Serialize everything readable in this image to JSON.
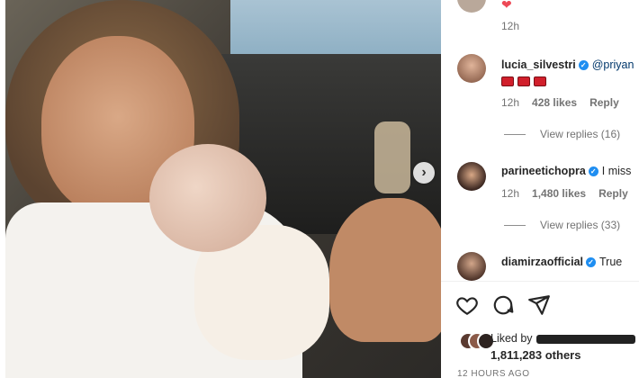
{
  "post": {
    "image_alt": "photo-of-woman-holding-baby"
  },
  "comments": [
    {
      "username": "",
      "text": "",
      "time": "12h",
      "likes": "",
      "reply": ""
    },
    {
      "username": "lucia_silvestri",
      "text": "@priyan",
      "time": "12h",
      "likes": "428 likes",
      "reply": "Reply",
      "view_replies": "View replies (16)"
    },
    {
      "username": "parineetichopra",
      "text": "I miss",
      "time": "12h",
      "likes": "1,480 likes",
      "reply": "Reply",
      "view_replies": "View replies (33)"
    },
    {
      "username": "diamirzaofficial",
      "text": "True"
    }
  ],
  "liked_by": {
    "label": "Liked by",
    "count": "1,811,283 others"
  },
  "timestamp": "12 HOURS AGO",
  "colors": {
    "verified": "#1f8ef1",
    "heart": "#ed4956",
    "muted": "#737373"
  }
}
